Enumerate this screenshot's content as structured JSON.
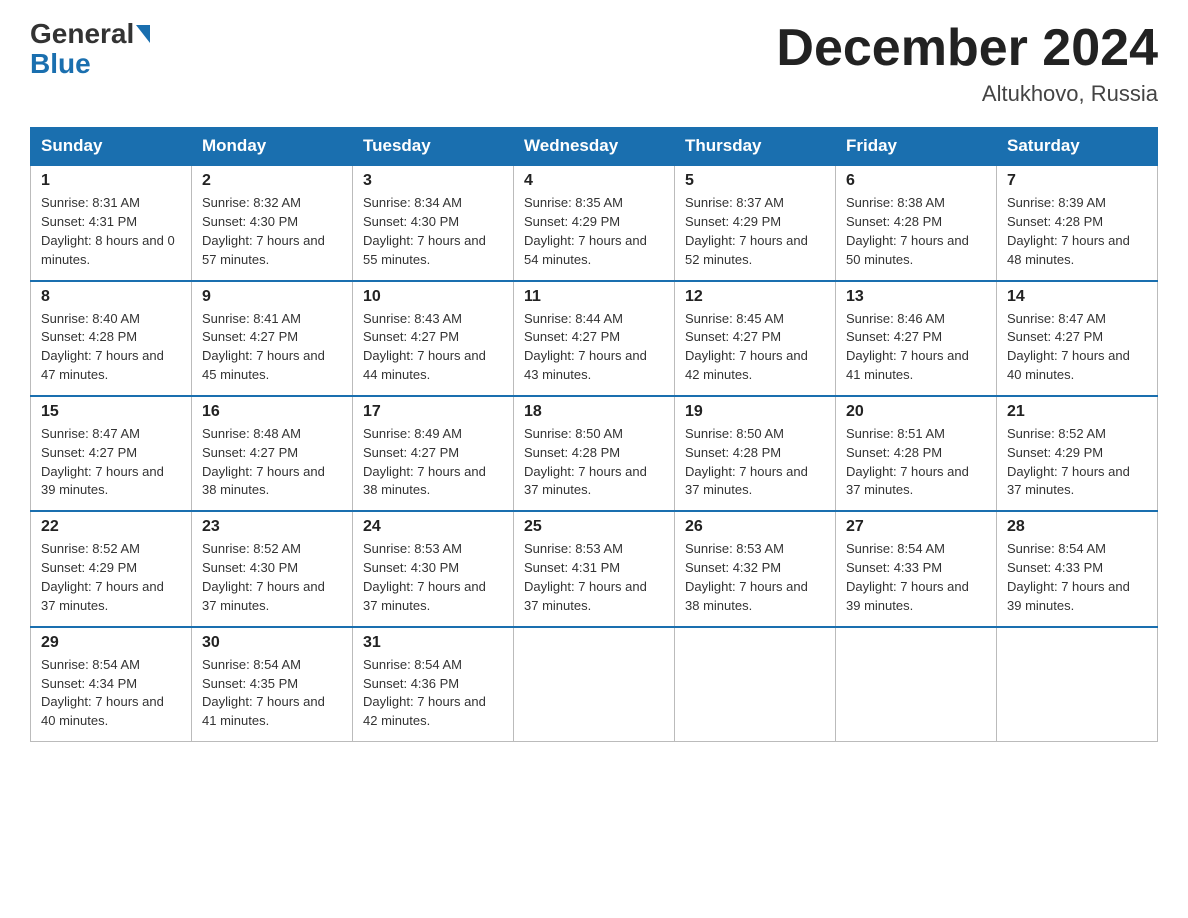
{
  "header": {
    "logo_line1": "General",
    "logo_line2": "Blue",
    "month_title": "December 2024",
    "location": "Altukhovo, Russia"
  },
  "days_of_week": [
    "Sunday",
    "Monday",
    "Tuesday",
    "Wednesday",
    "Thursday",
    "Friday",
    "Saturday"
  ],
  "weeks": [
    [
      {
        "num": "1",
        "sunrise": "8:31 AM",
        "sunset": "4:31 PM",
        "daylight": "8 hours and 0 minutes."
      },
      {
        "num": "2",
        "sunrise": "8:32 AM",
        "sunset": "4:30 PM",
        "daylight": "7 hours and 57 minutes."
      },
      {
        "num": "3",
        "sunrise": "8:34 AM",
        "sunset": "4:30 PM",
        "daylight": "7 hours and 55 minutes."
      },
      {
        "num": "4",
        "sunrise": "8:35 AM",
        "sunset": "4:29 PM",
        "daylight": "7 hours and 54 minutes."
      },
      {
        "num": "5",
        "sunrise": "8:37 AM",
        "sunset": "4:29 PM",
        "daylight": "7 hours and 52 minutes."
      },
      {
        "num": "6",
        "sunrise": "8:38 AM",
        "sunset": "4:28 PM",
        "daylight": "7 hours and 50 minutes."
      },
      {
        "num": "7",
        "sunrise": "8:39 AM",
        "sunset": "4:28 PM",
        "daylight": "7 hours and 48 minutes."
      }
    ],
    [
      {
        "num": "8",
        "sunrise": "8:40 AM",
        "sunset": "4:28 PM",
        "daylight": "7 hours and 47 minutes."
      },
      {
        "num": "9",
        "sunrise": "8:41 AM",
        "sunset": "4:27 PM",
        "daylight": "7 hours and 45 minutes."
      },
      {
        "num": "10",
        "sunrise": "8:43 AM",
        "sunset": "4:27 PM",
        "daylight": "7 hours and 44 minutes."
      },
      {
        "num": "11",
        "sunrise": "8:44 AM",
        "sunset": "4:27 PM",
        "daylight": "7 hours and 43 minutes."
      },
      {
        "num": "12",
        "sunrise": "8:45 AM",
        "sunset": "4:27 PM",
        "daylight": "7 hours and 42 minutes."
      },
      {
        "num": "13",
        "sunrise": "8:46 AM",
        "sunset": "4:27 PM",
        "daylight": "7 hours and 41 minutes."
      },
      {
        "num": "14",
        "sunrise": "8:47 AM",
        "sunset": "4:27 PM",
        "daylight": "7 hours and 40 minutes."
      }
    ],
    [
      {
        "num": "15",
        "sunrise": "8:47 AM",
        "sunset": "4:27 PM",
        "daylight": "7 hours and 39 minutes."
      },
      {
        "num": "16",
        "sunrise": "8:48 AM",
        "sunset": "4:27 PM",
        "daylight": "7 hours and 38 minutes."
      },
      {
        "num": "17",
        "sunrise": "8:49 AM",
        "sunset": "4:27 PM",
        "daylight": "7 hours and 38 minutes."
      },
      {
        "num": "18",
        "sunrise": "8:50 AM",
        "sunset": "4:28 PM",
        "daylight": "7 hours and 37 minutes."
      },
      {
        "num": "19",
        "sunrise": "8:50 AM",
        "sunset": "4:28 PM",
        "daylight": "7 hours and 37 minutes."
      },
      {
        "num": "20",
        "sunrise": "8:51 AM",
        "sunset": "4:28 PM",
        "daylight": "7 hours and 37 minutes."
      },
      {
        "num": "21",
        "sunrise": "8:52 AM",
        "sunset": "4:29 PM",
        "daylight": "7 hours and 37 minutes."
      }
    ],
    [
      {
        "num": "22",
        "sunrise": "8:52 AM",
        "sunset": "4:29 PM",
        "daylight": "7 hours and 37 minutes."
      },
      {
        "num": "23",
        "sunrise": "8:52 AM",
        "sunset": "4:30 PM",
        "daylight": "7 hours and 37 minutes."
      },
      {
        "num": "24",
        "sunrise": "8:53 AM",
        "sunset": "4:30 PM",
        "daylight": "7 hours and 37 minutes."
      },
      {
        "num": "25",
        "sunrise": "8:53 AM",
        "sunset": "4:31 PM",
        "daylight": "7 hours and 37 minutes."
      },
      {
        "num": "26",
        "sunrise": "8:53 AM",
        "sunset": "4:32 PM",
        "daylight": "7 hours and 38 minutes."
      },
      {
        "num": "27",
        "sunrise": "8:54 AM",
        "sunset": "4:33 PM",
        "daylight": "7 hours and 39 minutes."
      },
      {
        "num": "28",
        "sunrise": "8:54 AM",
        "sunset": "4:33 PM",
        "daylight": "7 hours and 39 minutes."
      }
    ],
    [
      {
        "num": "29",
        "sunrise": "8:54 AM",
        "sunset": "4:34 PM",
        "daylight": "7 hours and 40 minutes."
      },
      {
        "num": "30",
        "sunrise": "8:54 AM",
        "sunset": "4:35 PM",
        "daylight": "7 hours and 41 minutes."
      },
      {
        "num": "31",
        "sunrise": "8:54 AM",
        "sunset": "4:36 PM",
        "daylight": "7 hours and 42 minutes."
      },
      null,
      null,
      null,
      null
    ]
  ]
}
